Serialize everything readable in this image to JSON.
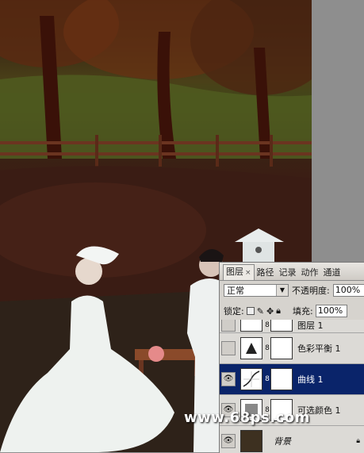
{
  "panel": {
    "tabs": [
      {
        "label": "图层",
        "active": true
      },
      {
        "label": "路径"
      },
      {
        "label": "记录"
      },
      {
        "label": "动作"
      },
      {
        "label": "通道"
      }
    ],
    "close_glyph": "×",
    "blend_mode": "正常",
    "opacity_label": "不透明度:",
    "opacity_value": "100%",
    "lock_label": "锁定:",
    "fill_label": "填充:",
    "fill_value": "100%",
    "layers": [
      {
        "name": "图层 1",
        "visible": false,
        "selected": false
      },
      {
        "name": "色彩平衡 1",
        "visible": false,
        "selected": false
      },
      {
        "name": "曲线 1",
        "visible": true,
        "selected": true
      },
      {
        "name": "可选颜色 1",
        "visible": true,
        "selected": false
      },
      {
        "name": "背景",
        "visible": true,
        "selected": false,
        "locked": true
      }
    ]
  },
  "watermark": "www.68ps.com",
  "colors": {
    "selected_layer": "#0a246a",
    "panel_bg": "#d6d3ce"
  }
}
